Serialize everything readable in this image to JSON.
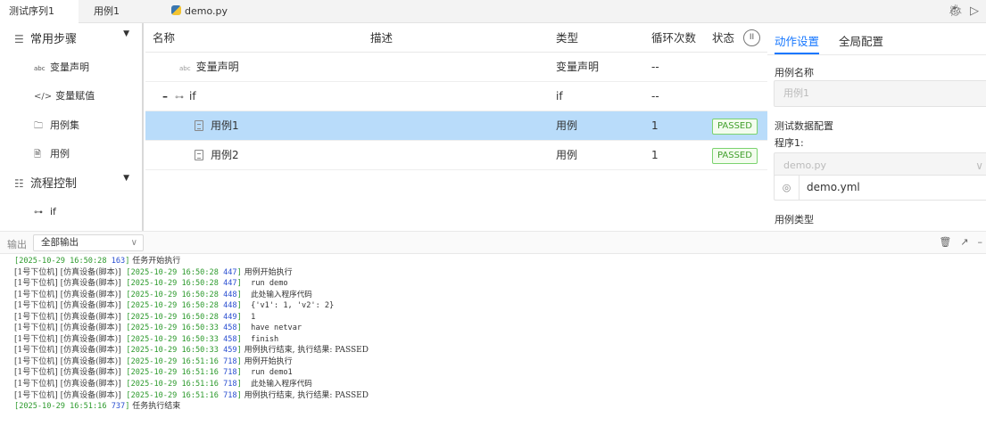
{
  "tabs": [
    {
      "label": "测试序列1",
      "active": true
    },
    {
      "label": "用例1",
      "active": false
    },
    {
      "label": "demo.py",
      "active": false,
      "icon": "python-icon"
    }
  ],
  "toolbar_icons": [
    "debug-icon",
    "run-icon"
  ],
  "sidebar": {
    "groups": [
      {
        "label": "常用步骤",
        "icon": "list-icon",
        "items": [
          {
            "label": "变量声明",
            "icon": "abc-icon"
          },
          {
            "label": "变量赋值",
            "icon": "code-icon"
          },
          {
            "label": "用例集",
            "icon": "folder-icon"
          },
          {
            "label": "用例",
            "icon": "document-icon"
          }
        ]
      },
      {
        "label": "流程控制",
        "icon": "flow-icon",
        "items": [
          {
            "label": "if",
            "icon": "branch-icon"
          }
        ]
      }
    ]
  },
  "table": {
    "headers": {
      "name": "名称",
      "desc": "描述",
      "type": "类型",
      "loop": "循环次数",
      "status": "状态"
    },
    "rows": [
      {
        "name": "变量声明",
        "desc": "",
        "type": "变量声明",
        "loop": "--",
        "status": ""
      },
      {
        "name": "if",
        "desc": "",
        "type": "if",
        "loop": "--",
        "status": ""
      },
      {
        "name": "用例1",
        "desc": "",
        "type": "用例",
        "loop": "1",
        "status": "PASSED",
        "selected": true
      },
      {
        "name": "用例2",
        "desc": "",
        "type": "用例",
        "loop": "1",
        "status": "PASSED"
      }
    ]
  },
  "right_panel": {
    "tabs": [
      "动作设置",
      "全局配置"
    ],
    "active_tab": "动作设置",
    "case_name_label": "用例名称",
    "case_name_value": "用例1",
    "test_data_label": "测试数据配置",
    "program_label": "程序1:",
    "program_select": "demo.py",
    "data_file": "demo.yml",
    "case_type_label": "用例类型"
  },
  "output": {
    "label": "输出",
    "filter": "全部输出",
    "lines": [
      {
        "prefix": "",
        "ts": "2025-10-29 16:50:28",
        "ms": "163",
        "msg": " 任务开始执行"
      },
      {
        "prefix": "[1号下位机] [仿真设备(脚本)]  ",
        "ts": "2025-10-29 16:50:28",
        "ms": "447",
        "msg": " 用例开始执行"
      },
      {
        "prefix": "[1号下位机] [仿真设备(脚本)]  ",
        "ts": "2025-10-29 16:50:28",
        "ms": "447",
        "msg": "  run demo"
      },
      {
        "prefix": "[1号下位机] [仿真设备(脚本)]  ",
        "ts": "2025-10-29 16:50:28",
        "ms": "448",
        "msg": "  此处输入程序代码"
      },
      {
        "prefix": "[1号下位机] [仿真设备(脚本)]  ",
        "ts": "2025-10-29 16:50:28",
        "ms": "448",
        "msg": "  {'v1': 1, 'v2': 2}"
      },
      {
        "prefix": "[1号下位机] [仿真设备(脚本)]  ",
        "ts": "2025-10-29 16:50:28",
        "ms": "449",
        "msg": "  1"
      },
      {
        "prefix": "[1号下位机] [仿真设备(脚本)]  ",
        "ts": "2025-10-29 16:50:33",
        "ms": "458",
        "msg": "  have netvar"
      },
      {
        "prefix": "[1号下位机] [仿真设备(脚本)]  ",
        "ts": "2025-10-29 16:50:33",
        "ms": "458",
        "msg": "  finish"
      },
      {
        "prefix": "[1号下位机] [仿真设备(脚本)]  ",
        "ts": "2025-10-29 16:50:33",
        "ms": "459",
        "msg": " 用例执行结束, 执行结果: PASSED"
      },
      {
        "prefix": "[1号下位机] [仿真设备(脚本)]  ",
        "ts": "2025-10-29 16:51:16",
        "ms": "718",
        "msg": " 用例开始执行"
      },
      {
        "prefix": "[1号下位机] [仿真设备(脚本)]  ",
        "ts": "2025-10-29 16:51:16",
        "ms": "718",
        "msg": "  run demo1"
      },
      {
        "prefix": "[1号下位机] [仿真设备(脚本)]  ",
        "ts": "2025-10-29 16:51:16",
        "ms": "718",
        "msg": "  此处输入程序代码"
      },
      {
        "prefix": "[1号下位机] [仿真设备(脚本)]  ",
        "ts": "2025-10-29 16:51:16",
        "ms": "718",
        "msg": " 用例执行结束, 执行结果: PASSED"
      },
      {
        "prefix": "",
        "ts": "2025-10-29 16:51:16",
        "ms": "737",
        "msg": " 任务执行结束"
      }
    ]
  },
  "colors": {
    "accent": "#1677ff",
    "selected_row": "#b9dcfa",
    "passed": "#43a02e",
    "timestamp": "#2d9a2d",
    "millis": "#2a4fd1"
  }
}
